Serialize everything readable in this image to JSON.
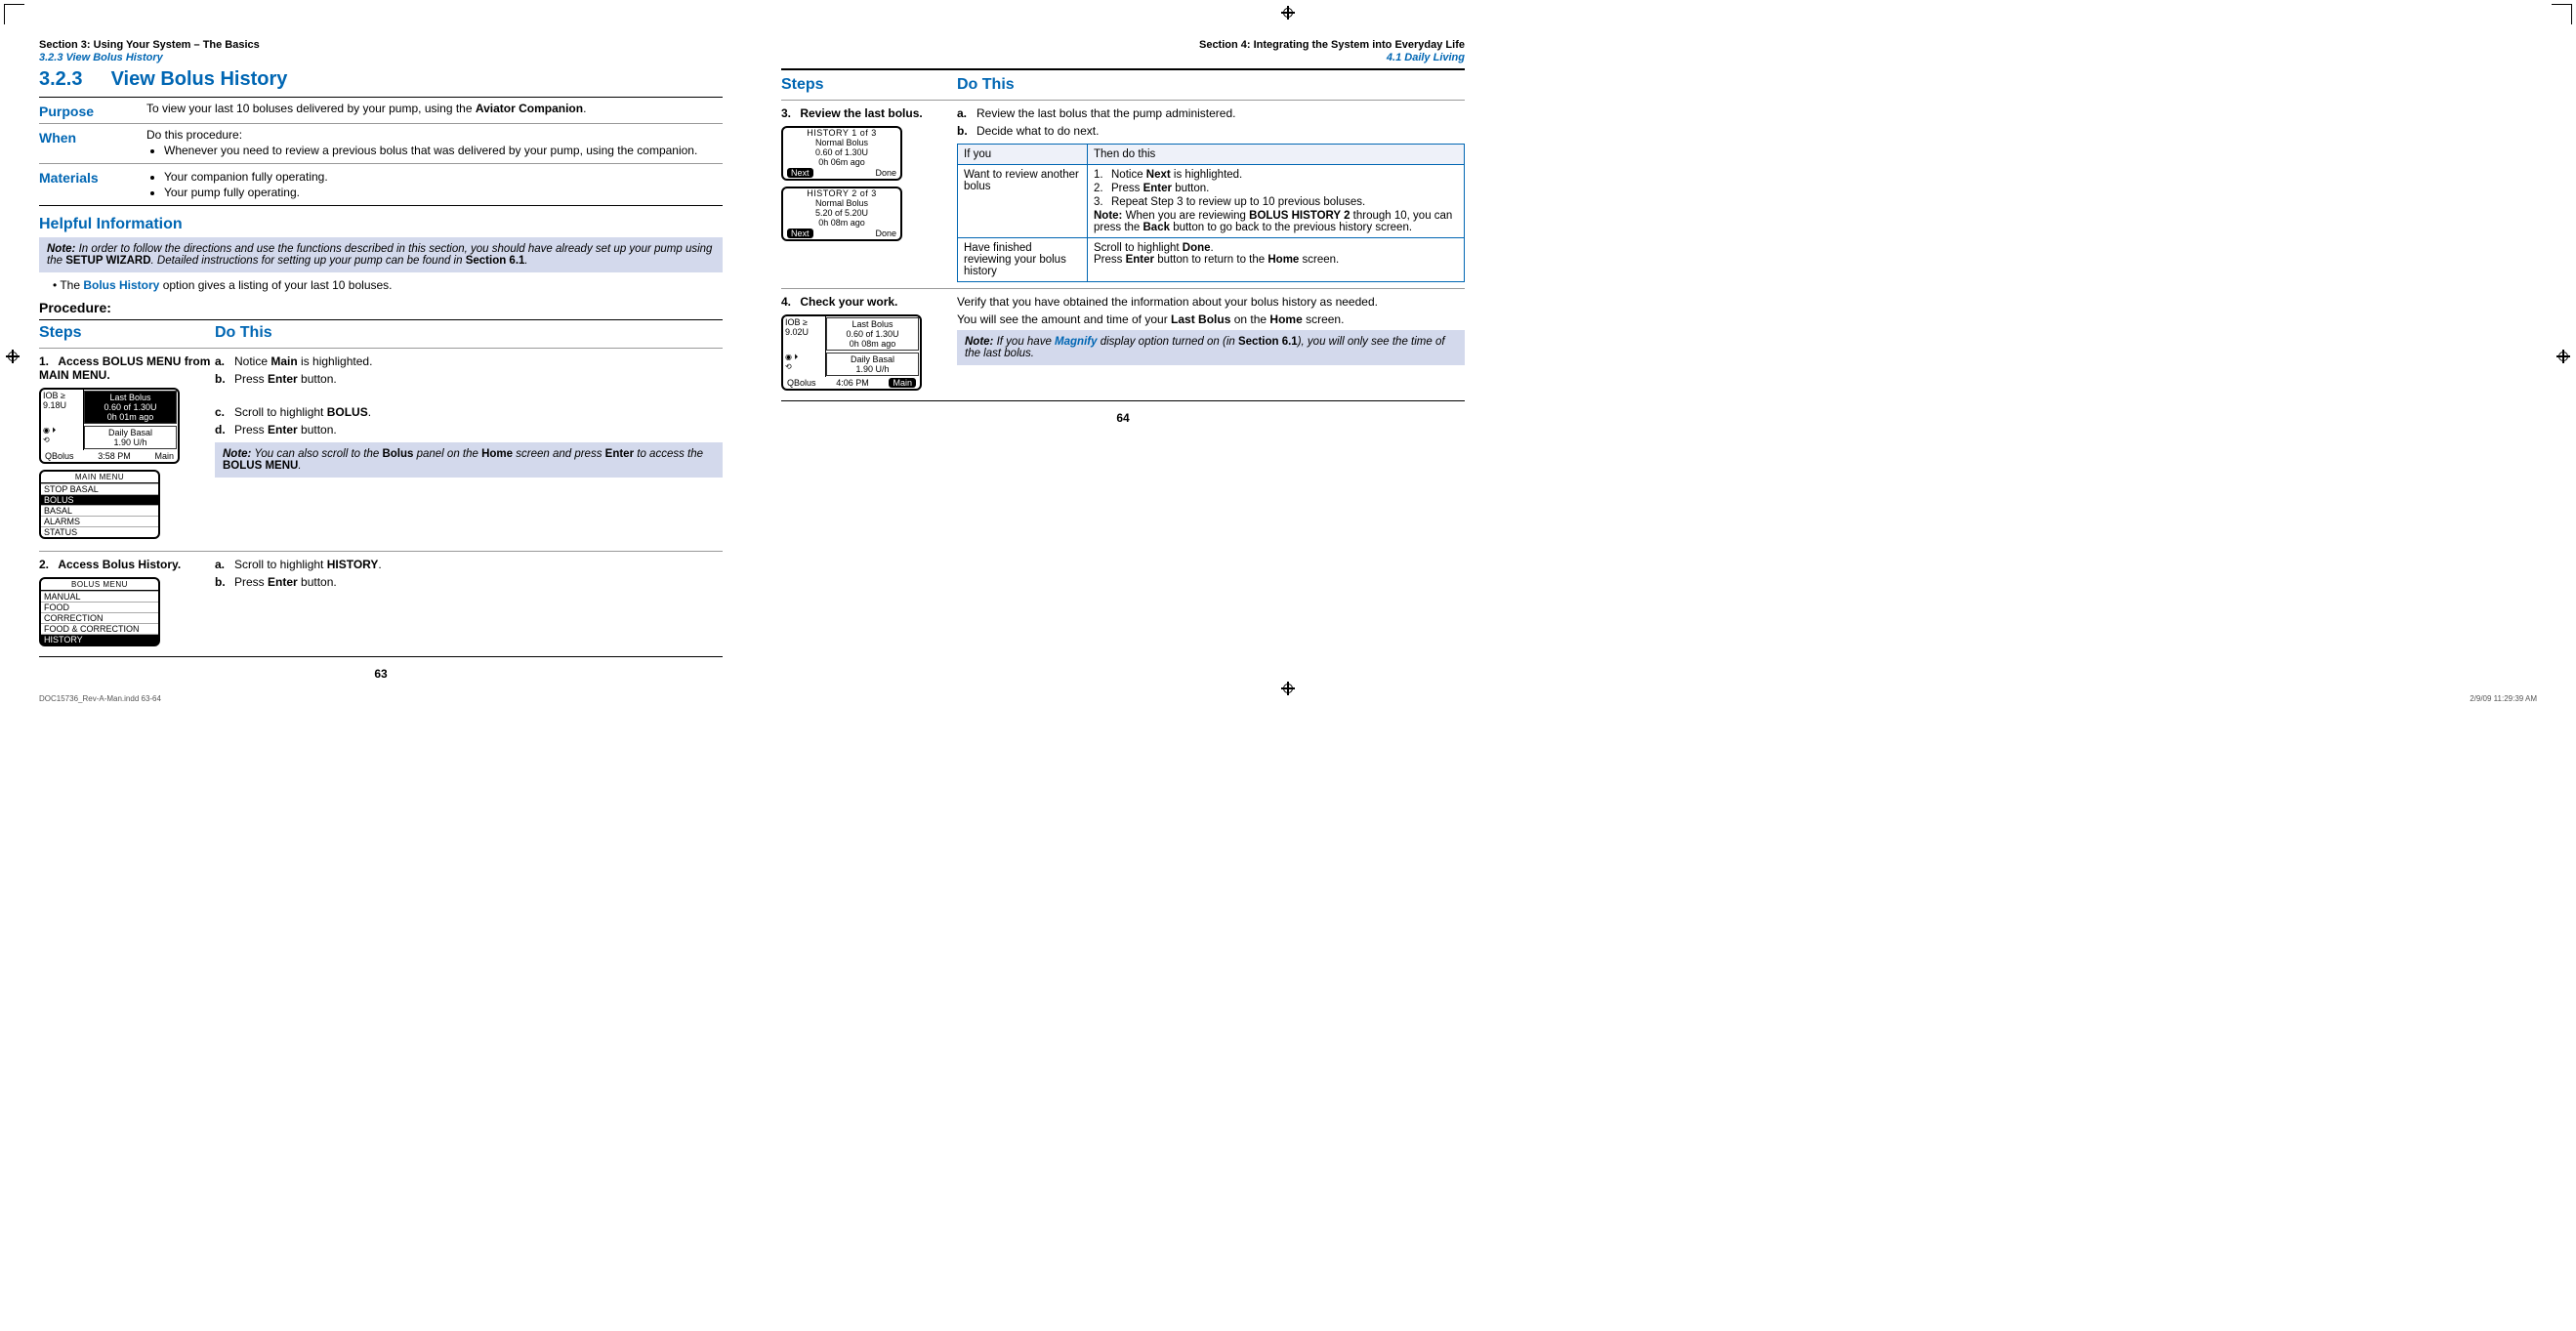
{
  "left_page": {
    "running_head_1": "Section 3: Using Your System – The Basics",
    "running_head_2": "3.2.3 View Bolus History",
    "section_number": "3.2.3",
    "section_title": "View Bolus History",
    "purpose_label": "Purpose",
    "purpose_text_a": "To view your last 10 boluses delivered by your pump, using the ",
    "purpose_text_b": "Aviator Companion",
    "when_label": "When",
    "when_intro": "Do this procedure:",
    "when_bullet": "Whenever you need to review a previous bolus that was delivered by your pump, using the companion.",
    "materials_label": "Materials",
    "materials_b1": "Your companion fully operating.",
    "materials_b2": "Your pump fully operating.",
    "helpful_title": "Helpful Information",
    "note1_label": "Note:",
    "note1_a": " In order to follow the directions and use the functions described in this section, you should have already set up your pump using the ",
    "note1_b": "SETUP WIZARD",
    "note1_c": ". Detailed instructions for setting up your pump can be found in ",
    "note1_d": "Section 6.1",
    "note1_e": ".",
    "bh_a": "The ",
    "bh_kw": "Bolus History",
    "bh_b": " option gives a listing of your last 10 boluses.",
    "procedure_label": "Procedure:",
    "steps_label": "Steps",
    "do_this_label": "Do This",
    "step1_num": "1.",
    "step1_title_a": "Access ",
    "step1_title_b": "BOLUS MENU",
    "step1_title_c": " from ",
    "step1_title_d": "MAIN MENU",
    "s1a_a": "Notice ",
    "s1a_b": "Main",
    "s1a_c": " is highlighted.",
    "s1b_a": "Press ",
    "s1b_b": "Enter",
    "s1b_c": " button.",
    "s1c_a": "Scroll to highlight ",
    "s1c_b": "BOLUS",
    "s1c_c": ".",
    "s1d_a": "Press ",
    "s1d_b": "Enter",
    "s1d_c": " button.",
    "s1_note_label": "Note:",
    "s1_note_a": " You can also scroll to the ",
    "s1_note_b": "Bolus",
    "s1_note_c": " panel on the ",
    "s1_note_d": "Home",
    "s1_note_e": " screen and press ",
    "s1_note_f": "Enter",
    "s1_note_g": " to access the ",
    "s1_note_h": "BOLUS MENU",
    "s1_note_i": ".",
    "step2_num": "2.",
    "step2_title": "Access Bolus History.",
    "s2a_a": "Scroll to highlight ",
    "s2a_b": "HISTORY",
    "s2a_c": ".",
    "s2b_a": "Press ",
    "s2b_b": "Enter",
    "s2b_c": " button.",
    "page_number": "63",
    "lcd1": {
      "iob_lbl": "IOB ≥",
      "iob_val": "9.18U",
      "last_bolus": "Last Bolus",
      "lb_amt": "0.60 of 1.30U",
      "lb_time": "0h 01m ago",
      "basal": "Daily Basal",
      "basal_rate": "1.90 U/h",
      "qbolus": "QBolus",
      "time": "3:58 PM",
      "main": "Main"
    },
    "lcd2": {
      "title": "MAIN MENU",
      "items": [
        "STOP BASAL",
        "BOLUS",
        "BASAL",
        "ALARMS",
        "STATUS"
      ],
      "selected_index": 1
    },
    "lcd3": {
      "title": "BOLUS MENU",
      "items": [
        "MANUAL",
        "FOOD",
        "CORRECTION",
        "FOOD & CORRECTION",
        "HISTORY"
      ],
      "selected_index": 4
    }
  },
  "right_page": {
    "running_head_1": "Section 4: Integrating the System into Everyday Life",
    "running_head_2": "4.1 Daily Living",
    "steps_label": "Steps",
    "do_this_label": "Do This",
    "step3_num": "3.",
    "step3_title": "Review the last bolus.",
    "s3a_a": "Review the last bolus that the pump administered.",
    "s3b_a": "Decide what to do next.",
    "tbl_h1": "If you",
    "tbl_h2": "Then do this",
    "r1c1": "Want to review another bolus",
    "r1_1a": "Notice ",
    "r1_1b": "Next",
    "r1_1c": " is highlighted.",
    "r1_2a": "Press ",
    "r1_2b": "Enter",
    "r1_2c": " button.",
    "r1_3": "Repeat Step 3 to review up to 10 previous boluses.",
    "r1_note_lbl": "Note:",
    "r1_note_a": " When you are reviewing ",
    "r1_note_b": "BOLUS HISTORY 2",
    "r1_note_c": " through 10, you can press the ",
    "r1_note_d": "Back",
    "r1_note_e": " button to go back to the previous history screen.",
    "r2c1": "Have finished reviewing your bolus history",
    "r2_a": "Scroll to highlight ",
    "r2_b": "Done",
    "r2_c": ".",
    "r2_d": "Press ",
    "r2_e": "Enter",
    "r2_f": " button to return to the ",
    "r2_g": "Home",
    "r2_h": " screen.",
    "step4_num": "4.",
    "step4_title": "Check your work.",
    "s4_line1": "Verify that you have obtained the information about your bolus history as needed.",
    "s4_line2a": "You will see the amount and time of your ",
    "s4_line2b": "Last Bolus",
    "s4_line2c": " on the ",
    "s4_line2d": "Home",
    "s4_line2e": " screen.",
    "s4_note_lbl": "Note:",
    "s4_note_a": " If you have ",
    "s4_note_b": "Magnify",
    "s4_note_c": " display option turned on (in ",
    "s4_note_d": "Section 6.1",
    "s4_note_e": "), you will only see the time of the last bolus.",
    "page_number": "64",
    "lcd_h1": {
      "title": "HISTORY 1 of 3",
      "l1": "Normal Bolus",
      "l2": "0.60 of 1.30U",
      "l3": "0h 06m ago",
      "next": "Next",
      "done": "Done"
    },
    "lcd_h2": {
      "title": "HISTORY 2 of 3",
      "l1": "Normal Bolus",
      "l2": "5.20 of 5.20U",
      "l3": "0h 08m ago",
      "next": "Next",
      "done": "Done"
    },
    "lcd4": {
      "iob_lbl": "IOB ≥",
      "iob_val": "9.02U",
      "last_bolus": "Last Bolus",
      "lb_amt": "0.60 of 1.30U",
      "lb_time": "0h 08m ago",
      "basal": "Daily Basal",
      "basal_rate": "1.90 U/h",
      "qbolus": "QBolus",
      "time": "4:06 PM",
      "main": "Main"
    }
  },
  "footer": {
    "file": "DOC15736_Rev-A-Man.indd   63-64",
    "stamp": "2/9/09   11:29:39 AM"
  }
}
